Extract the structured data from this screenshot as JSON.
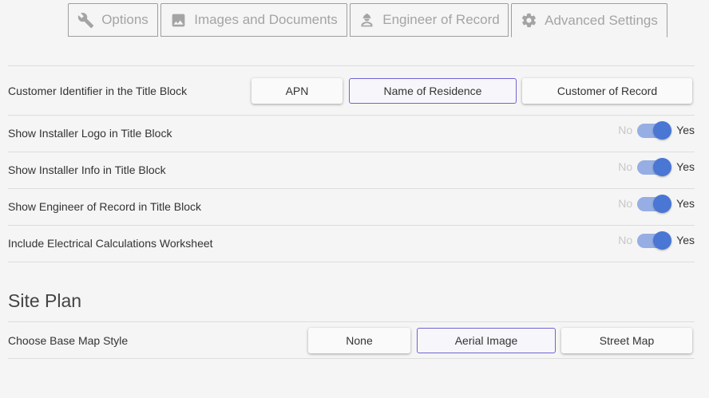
{
  "tabs": [
    {
      "label": "Options",
      "icon": "wrench-icon"
    },
    {
      "label": "Images and Documents",
      "icon": "image-icon"
    },
    {
      "label": "Engineer of Record",
      "icon": "engineer-icon"
    },
    {
      "label": "Advanced Settings",
      "icon": "gear-icon",
      "active": true
    }
  ],
  "title_block": {
    "customer_identifier": {
      "label": "Customer Identifier in the Title Block",
      "options": [
        "APN",
        "Name of Residence",
        "Customer of Record"
      ],
      "selected": "Name of Residence"
    },
    "toggles": [
      {
        "label": "Show Installer Logo in Title Block",
        "off_label": "No",
        "on_label": "Yes",
        "value": true
      },
      {
        "label": "Show Installer Info in Title Block",
        "off_label": "No",
        "on_label": "Yes",
        "value": true
      },
      {
        "label": "Show Engineer of Record in Title Block",
        "off_label": "No",
        "on_label": "Yes",
        "value": true
      },
      {
        "label": "Include Electrical Calculations Worksheet",
        "off_label": "No",
        "on_label": "Yes",
        "value": true
      }
    ]
  },
  "site_plan": {
    "title": "Site Plan",
    "base_map": {
      "label": "Choose Base Map Style",
      "options": [
        "None",
        "Aerial Image",
        "Street Map"
      ],
      "selected": "Aerial Image"
    }
  },
  "colors": {
    "accent": "#4a76d4",
    "accent_light": "#96aee3",
    "selected_border": "#6f63d6"
  }
}
